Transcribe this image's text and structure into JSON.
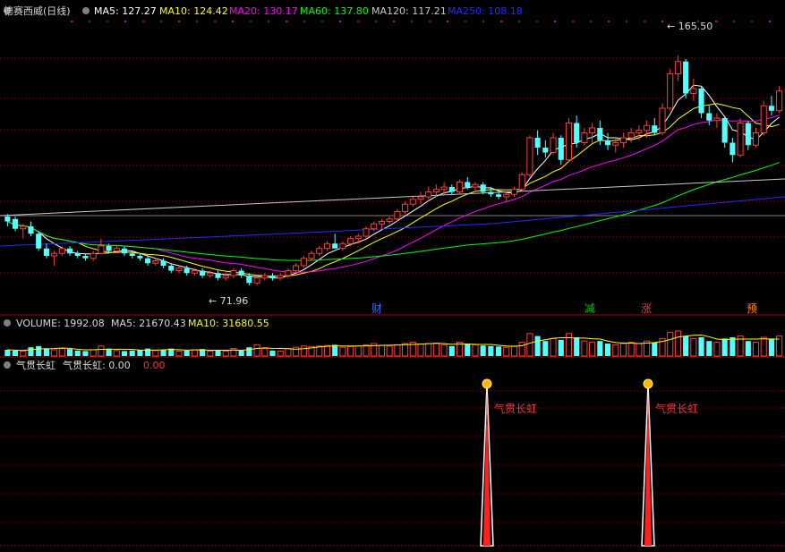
{
  "header": {
    "stock": "德赛西威(日线)",
    "ma": [
      {
        "label": "MA5: 127.27",
        "color": "#ffffff"
      },
      {
        "label": "MA10: 124.42",
        "color": "#ffff00"
      },
      {
        "label": "MA20: 130.17",
        "color": "#ff00ff"
      },
      {
        "label": "MA60: 137.80",
        "color": "#00ff00"
      },
      {
        "label": "MA120: 117.21",
        "color": "#c8c8c8"
      },
      {
        "label": "MA250: 108.18",
        "color": "#2828ff"
      }
    ]
  },
  "price_annotations": {
    "high": "165.50",
    "low": "71.96"
  },
  "events": [
    {
      "label": "财",
      "color": "#2a6cff"
    },
    {
      "label": "减",
      "color": "#00c000"
    },
    {
      "label": "涨",
      "color": "#ff3030"
    },
    {
      "label": "预",
      "color": "#ff8c00"
    }
  ],
  "volume_header": {
    "title": "VOLUME: 1992.08",
    "ma5": "MA5: 21670.43",
    "ma10": "MA10: 31680.55"
  },
  "indicator_header": {
    "name": "气贯长虹",
    "value": "气贯长虹: 0.00",
    "value2": "0.00"
  },
  "signal_label": "气贯长虹",
  "colors": {
    "up": "#ff3c3c",
    "down": "#54ffff",
    "grid": "#8b0000",
    "axis": "#b00000"
  },
  "chart_data": {
    "type": "candlestick",
    "price_ylim": [
      60,
      180
    ],
    "candles": [
      [
        100,
        101,
        96,
        98
      ],
      [
        99,
        100,
        94,
        95
      ],
      [
        95,
        97,
        91,
        96
      ],
      [
        96,
        98,
        92,
        93
      ],
      [
        93,
        94,
        86,
        87
      ],
      [
        87,
        89,
        83,
        84
      ],
      [
        84,
        86,
        80,
        85
      ],
      [
        85,
        88,
        84,
        87
      ],
      [
        87,
        88,
        84,
        85
      ],
      [
        85,
        86,
        83,
        84
      ],
      [
        84,
        85,
        82,
        83
      ],
      [
        83,
        86,
        82,
        85
      ],
      [
        85,
        91,
        85,
        88
      ],
      [
        88,
        89,
        85,
        86
      ],
      [
        86,
        88,
        85,
        87
      ],
      [
        87,
        88,
        84,
        85
      ],
      [
        85,
        86,
        83,
        84
      ],
      [
        84,
        85,
        82,
        83
      ],
      [
        83,
        84,
        80,
        81
      ],
      [
        81,
        83,
        80,
        82
      ],
      [
        82,
        83,
        79,
        80
      ],
      [
        80,
        81,
        77,
        78
      ],
      [
        78,
        80,
        77,
        79
      ],
      [
        79,
        80,
        76,
        77
      ],
      [
        77,
        79,
        76,
        78
      ],
      [
        78,
        79,
        75,
        76
      ],
      [
        76,
        78,
        75,
        77
      ],
      [
        77,
        78,
        74,
        75
      ],
      [
        75,
        77,
        74,
        76
      ],
      [
        76,
        79,
        75,
        78
      ],
      [
        78,
        79,
        75,
        76
      ],
      [
        76,
        77,
        72,
        73
      ],
      [
        73,
        76,
        71.96,
        75
      ],
      [
        75,
        77,
        74,
        76
      ],
      [
        76,
        77,
        74,
        75
      ],
      [
        75,
        77,
        74,
        76
      ],
      [
        76,
        79,
        75,
        78
      ],
      [
        78,
        81,
        77,
        80
      ],
      [
        80,
        84,
        79,
        83
      ],
      [
        83,
        86,
        82,
        85
      ],
      [
        85,
        88,
        84,
        87
      ],
      [
        87,
        90,
        86,
        89
      ],
      [
        89,
        93,
        88,
        87
      ],
      [
        87,
        90,
        86,
        89
      ],
      [
        89,
        92,
        88,
        91
      ],
      [
        91,
        93,
        89,
        92
      ],
      [
        92,
        96,
        91,
        95
      ],
      [
        95,
        98,
        94,
        97
      ],
      [
        97,
        99,
        95,
        98
      ],
      [
        98,
        100,
        97,
        99
      ],
      [
        99,
        103,
        98,
        102
      ],
      [
        102,
        106,
        101,
        105
      ],
      [
        105,
        108,
        104,
        107
      ],
      [
        107,
        110,
        105,
        108
      ],
      [
        108,
        112,
        107,
        110
      ],
      [
        110,
        113,
        108,
        111
      ],
      [
        111,
        114,
        109,
        112
      ],
      [
        112,
        113,
        109,
        110
      ],
      [
        110,
        115,
        109,
        114
      ],
      [
        114,
        116,
        111,
        112
      ],
      [
        112,
        114,
        110,
        113
      ],
      [
        113,
        114,
        109,
        110
      ],
      [
        110,
        112,
        108,
        109
      ],
      [
        109,
        111,
        107,
        108
      ],
      [
        108,
        110,
        106,
        109
      ],
      [
        109,
        112,
        108,
        111
      ],
      [
        111,
        118,
        110,
        117
      ],
      [
        117,
        133,
        116,
        132
      ],
      [
        132,
        135,
        125,
        128
      ],
      [
        128,
        131,
        124,
        126
      ],
      [
        126,
        134,
        125,
        132
      ],
      [
        132,
        133,
        121,
        123
      ],
      [
        123,
        140,
        122,
        138
      ],
      [
        138,
        141,
        128,
        130
      ],
      [
        130,
        136,
        129,
        134
      ],
      [
        134,
        138,
        130,
        136
      ],
      [
        136,
        139,
        129,
        131
      ],
      [
        131,
        134,
        127,
        129
      ],
      [
        129,
        132,
        126,
        130
      ],
      [
        130,
        134,
        128,
        132
      ],
      [
        132,
        136,
        130,
        134
      ],
      [
        134,
        137,
        131,
        135
      ],
      [
        135,
        139,
        132,
        137
      ],
      [
        137,
        140,
        133,
        134
      ],
      [
        134,
        146,
        133,
        144
      ],
      [
        144,
        160,
        143,
        158
      ],
      [
        158,
        165.5,
        155,
        163
      ],
      [
        163,
        164,
        148,
        150
      ],
      [
        150,
        156,
        147,
        152
      ],
      [
        152,
        153,
        140,
        142
      ],
      [
        142,
        145,
        137,
        139
      ],
      [
        139,
        142,
        136,
        140
      ],
      [
        140,
        141,
        128,
        130
      ],
      [
        130,
        132,
        122,
        125
      ],
      [
        125,
        140,
        124,
        138
      ],
      [
        138,
        139,
        127,
        129
      ],
      [
        129,
        136,
        128,
        134
      ],
      [
        134,
        147,
        133,
        145
      ],
      [
        145,
        149,
        141,
        143
      ],
      [
        143,
        153,
        142,
        151
      ]
    ],
    "volume": [
      0.25,
      0.22,
      0.2,
      0.35,
      0.4,
      0.3,
      0.25,
      0.3,
      0.28,
      0.22,
      0.2,
      0.25,
      0.4,
      0.3,
      0.22,
      0.2,
      0.22,
      0.25,
      0.3,
      0.22,
      0.25,
      0.3,
      0.2,
      0.22,
      0.25,
      0.28,
      0.2,
      0.22,
      0.2,
      0.3,
      0.22,
      0.35,
      0.45,
      0.3,
      0.22,
      0.2,
      0.3,
      0.35,
      0.4,
      0.38,
      0.4,
      0.42,
      0.45,
      0.35,
      0.38,
      0.4,
      0.45,
      0.5,
      0.42,
      0.4,
      0.45,
      0.5,
      0.55,
      0.48,
      0.5,
      0.52,
      0.45,
      0.4,
      0.55,
      0.5,
      0.45,
      0.42,
      0.4,
      0.38,
      0.35,
      0.4,
      0.55,
      0.9,
      0.8,
      0.6,
      0.7,
      0.65,
      0.9,
      0.75,
      0.6,
      0.55,
      0.6,
      0.5,
      0.45,
      0.5,
      0.55,
      0.5,
      0.6,
      0.55,
      0.7,
      0.95,
      1.0,
      0.8,
      0.7,
      0.75,
      0.6,
      0.55,
      0.7,
      0.75,
      0.8,
      0.6,
      0.55,
      0.75,
      0.7,
      0.8
    ],
    "signals": [
      67,
      84
    ]
  }
}
